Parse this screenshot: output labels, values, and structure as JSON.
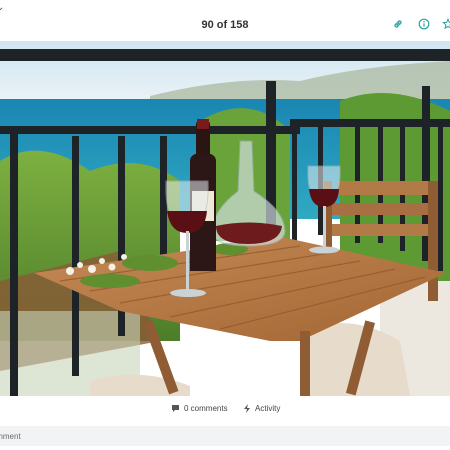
{
  "header": {
    "counter": "90 of 158",
    "icons": [
      "link-icon",
      "info-icon",
      "star-icon"
    ]
  },
  "photo": {
    "subject": "balcony table with wine bottle, decanter, two glasses of red wine and sea view"
  },
  "actions": {
    "comments_label": "0 comments",
    "activity_label": "Activity"
  },
  "comment_box": {
    "placeholder": "Comment"
  },
  "colors": {
    "accent": "#2aa3a3",
    "sea": "#1f8db5",
    "railing": "#1d2326",
    "table": "#b8794a"
  }
}
